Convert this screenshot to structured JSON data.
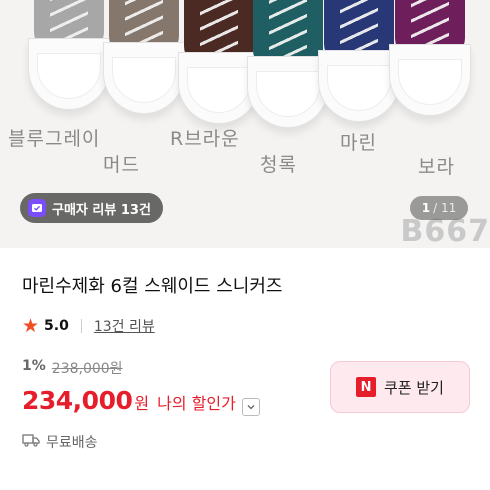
{
  "hero": {
    "color_labels": [
      "블루그레이",
      "머드",
      "R브라운",
      "청록",
      "마린",
      "보라"
    ],
    "watermark": "B667",
    "review_pill": {
      "icon": "review-badge-icon",
      "label": "구매자 리뷰 13건"
    },
    "pager": {
      "current": "1",
      "total": "/ 11"
    },
    "shoe_colors": [
      "#a7a7a7",
      "#85776c",
      "#4a2a22",
      "#1f5e63",
      "#283876",
      "#6e1e5a"
    ]
  },
  "product": {
    "title": "마린수제화 6컬 스웨이드 스니커즈",
    "rating": {
      "icon": "star-icon",
      "score": "5.0",
      "reviews": "13건 리뷰"
    },
    "discount_rate": "1%",
    "original_price": "238,000원",
    "sale_price": "234,000",
    "sale_currency": "원",
    "my_price_label": "나의 할인가",
    "dropdown_icon": "chevron-down-icon",
    "coupon": {
      "badge": "N",
      "label": "쿠폰 받기"
    },
    "shipping": {
      "icon": "truck-icon",
      "label": "무료배송"
    }
  },
  "colors": {
    "accent_red": "#e61e2b",
    "star": "#f04e23",
    "coupon_bg": "#fde9ee"
  }
}
